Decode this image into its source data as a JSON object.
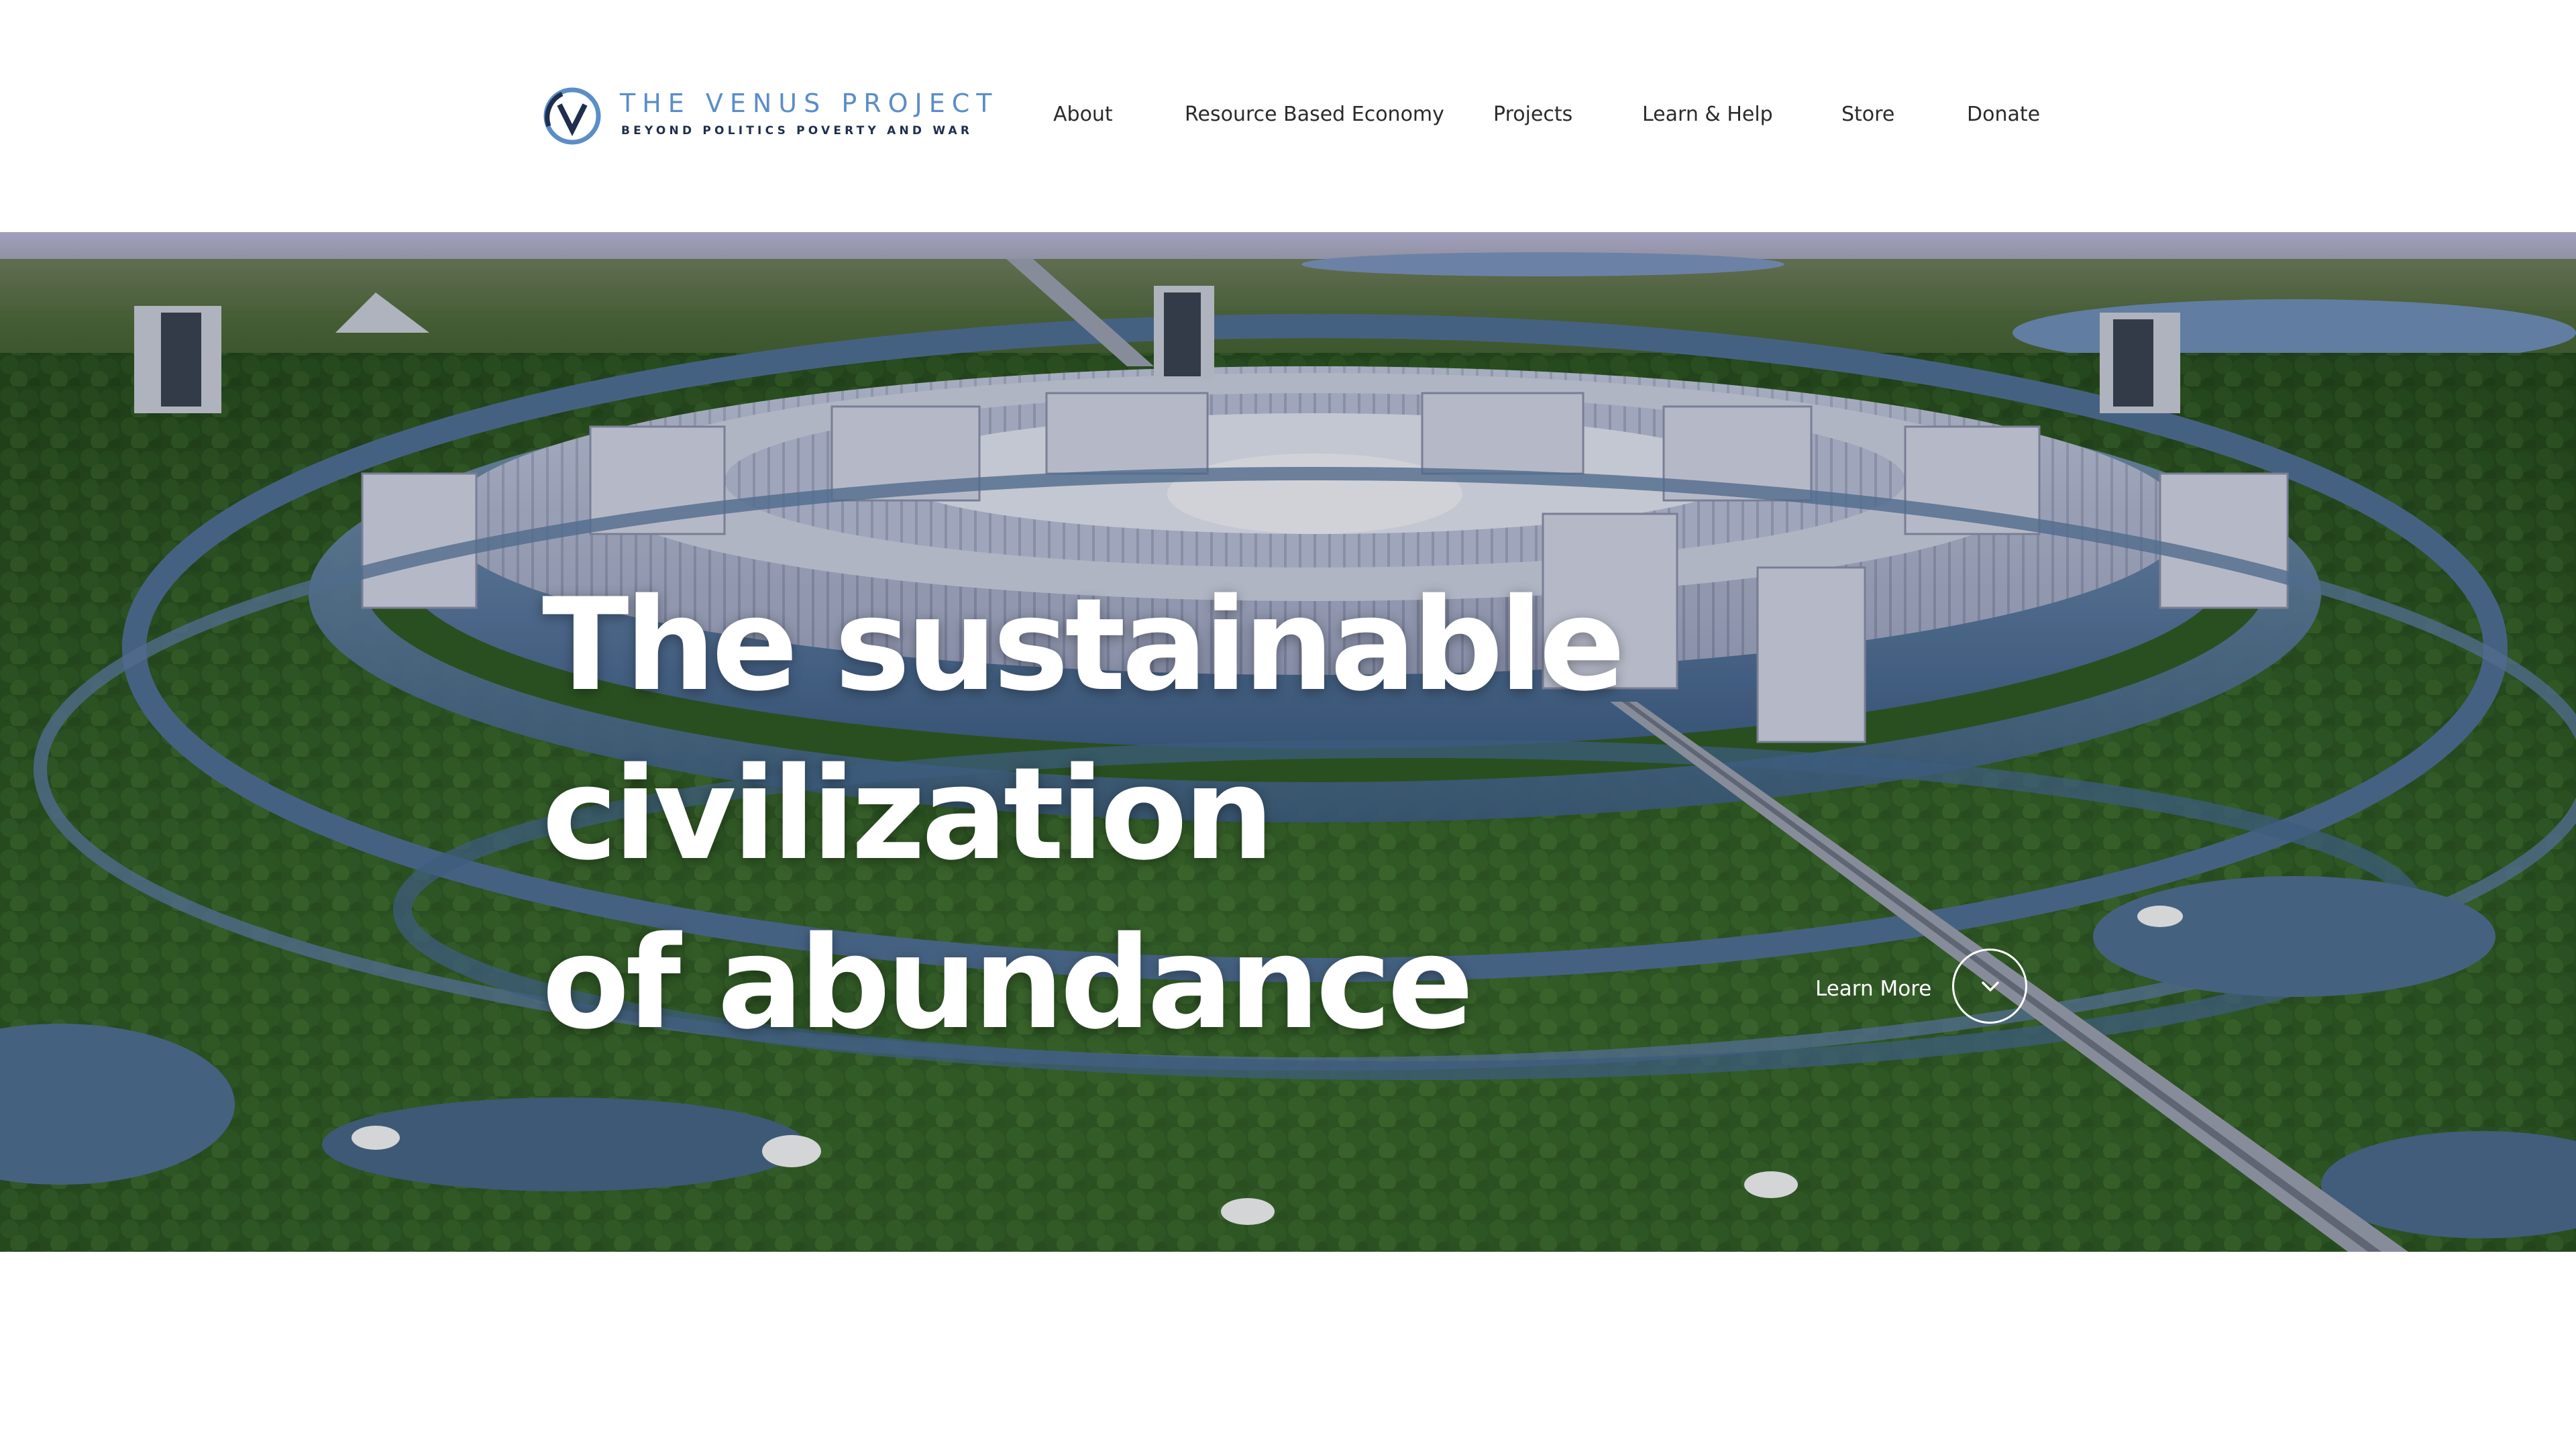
{
  "brand": {
    "title": "THE VENUS PROJECT",
    "tagline": "BEYOND POLITICS  POVERTY AND WAR",
    "accent_color": "#5b8ec6",
    "tagline_color": "#1e2f4d",
    "logo_icon": "venus-v-circle-icon"
  },
  "nav": {
    "items": [
      {
        "label": "About"
      },
      {
        "label": "Resource Based Economy"
      },
      {
        "label": "Projects"
      },
      {
        "label": "Learn & Help"
      },
      {
        "label": "Store"
      },
      {
        "label": "Donate"
      }
    ]
  },
  "hero": {
    "title_lines": [
      "The sustainable",
      "civilization",
      "of abundance"
    ],
    "background": "aerial-circular-city-render",
    "cta": {
      "label": "Learn More",
      "icon": "chevron-down-icon"
    }
  }
}
